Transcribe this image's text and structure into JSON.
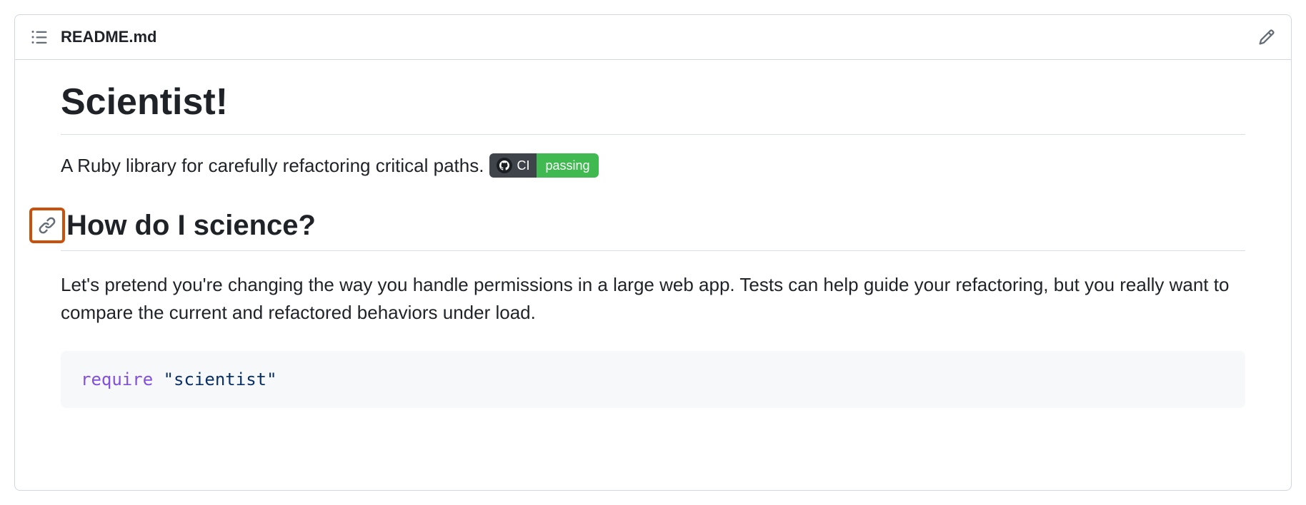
{
  "header": {
    "filename": "README.md"
  },
  "readme": {
    "title": "Scientist!",
    "description": "A Ruby library for carefully refactoring critical paths.",
    "badge": {
      "label": "CI",
      "value": "passing"
    },
    "subtitle": "How do I science?",
    "paragraph": "Let's pretend you're changing the way you handle permissions in a large web app. Tests can help guide your refactoring, but you really want to compare the current and refactored behaviors under load.",
    "code": {
      "keyword": "require",
      "string": "\"scientist\""
    }
  }
}
